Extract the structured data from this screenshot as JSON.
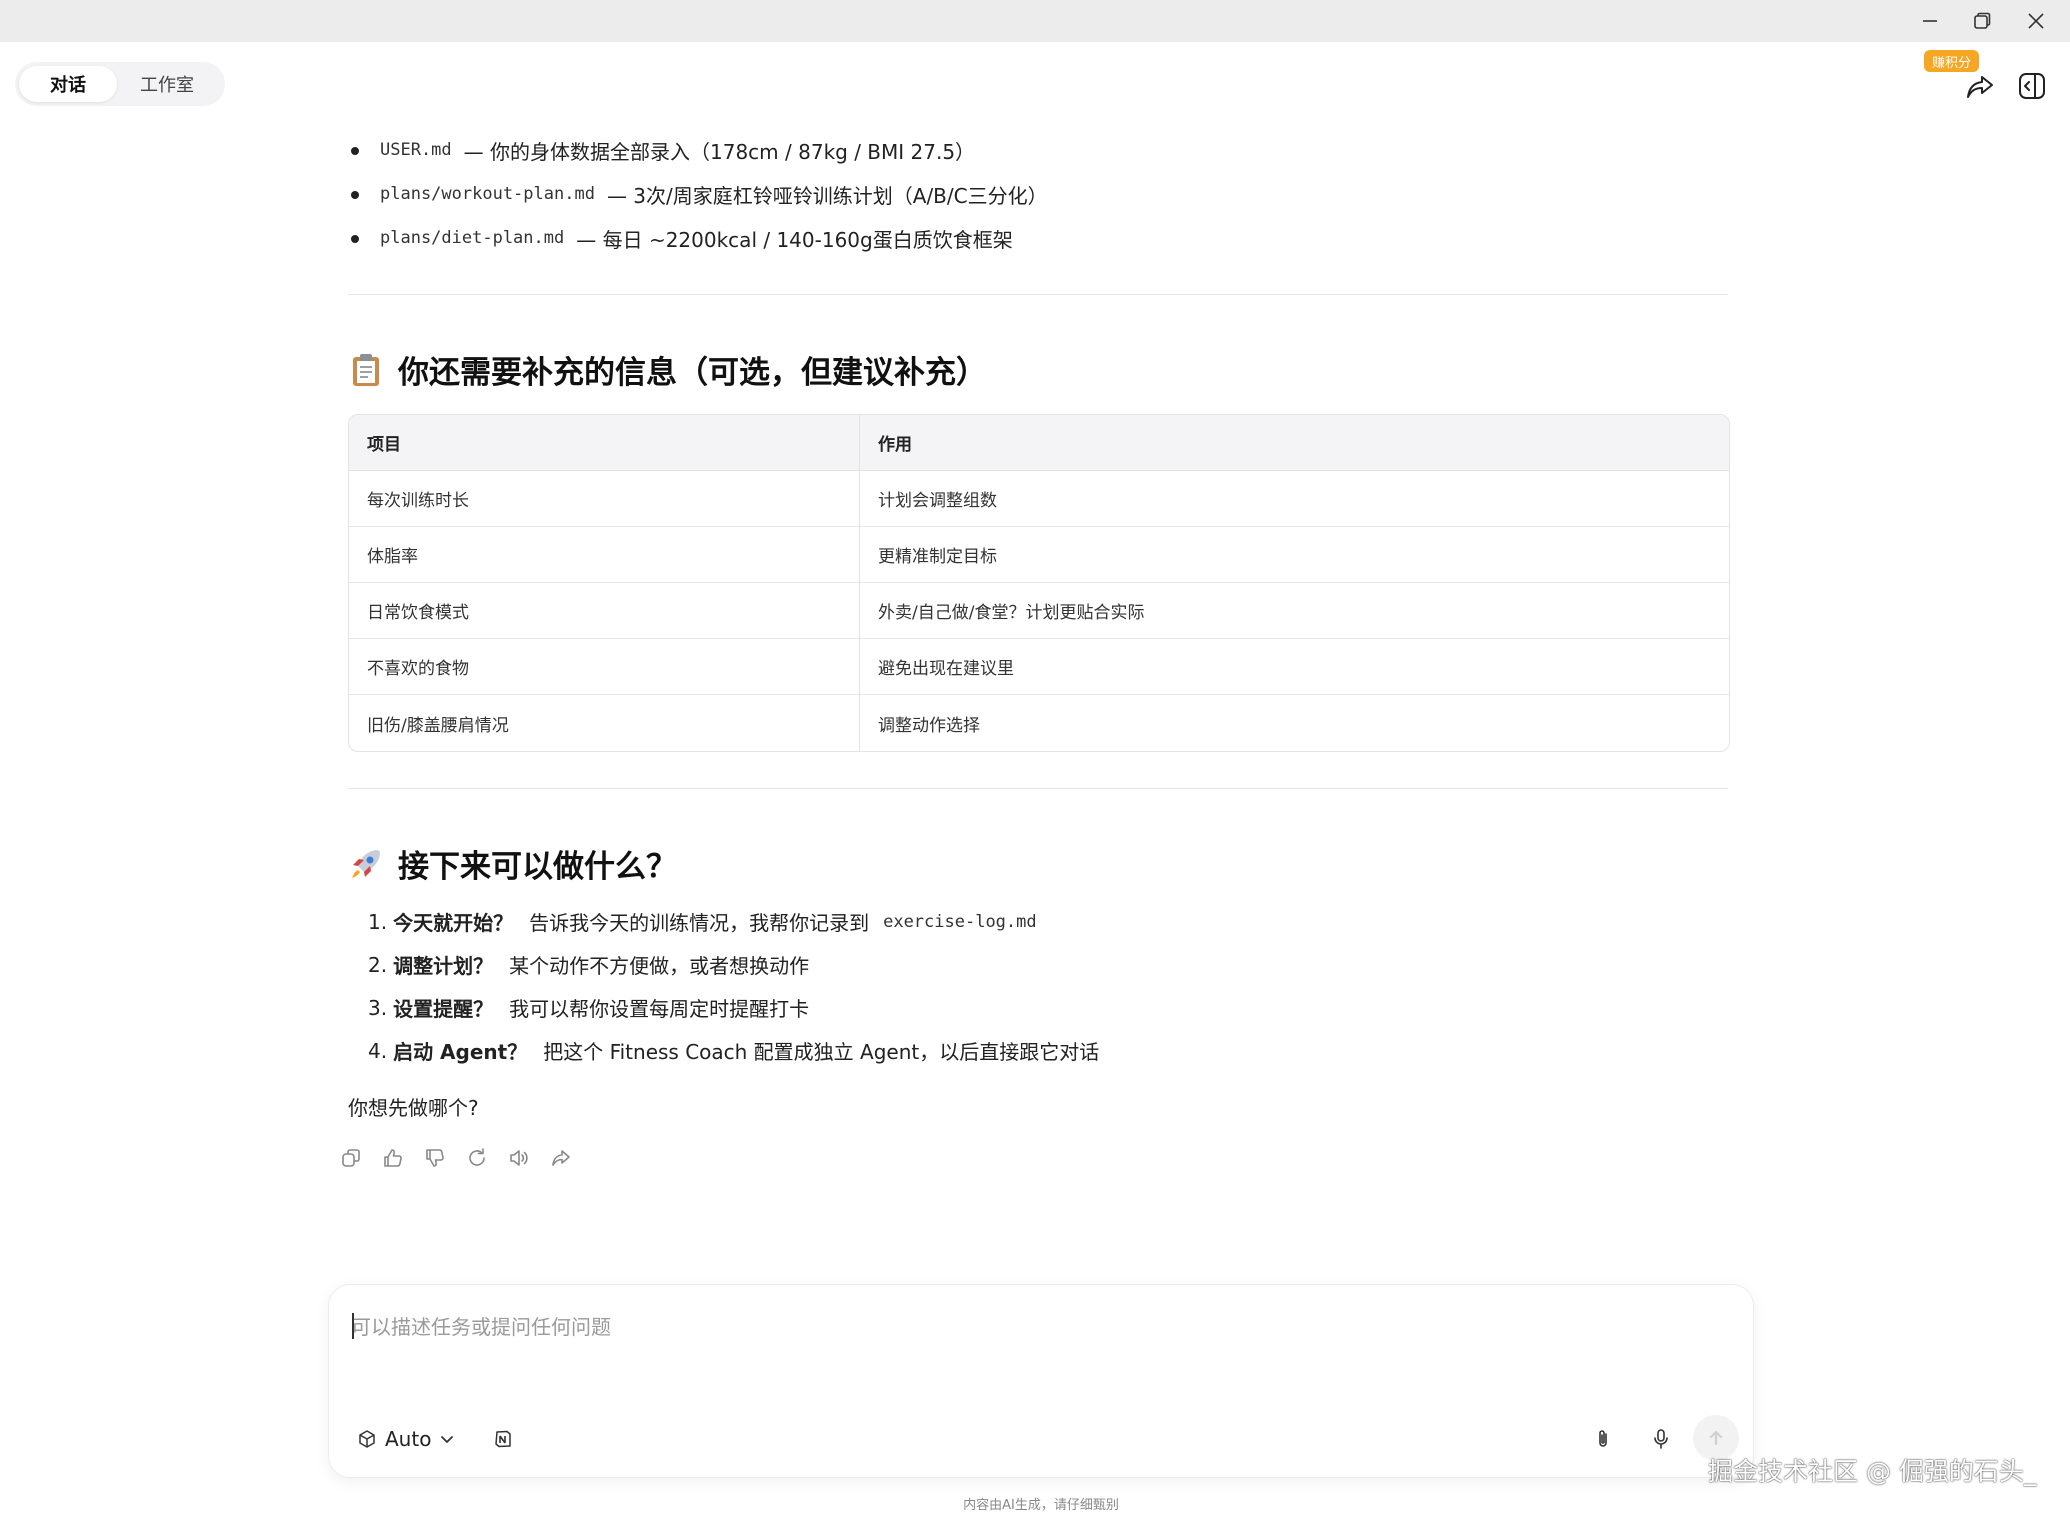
{
  "tabs": [
    {
      "label": "对话",
      "active": true
    },
    {
      "label": "工作室",
      "active": false
    }
  ],
  "header": {
    "points_badge": "赚积分"
  },
  "files": [
    {
      "code": "USER.md",
      "desc": "— 你的身体数据全部录入（178cm / 87kg / BMI 27.5）"
    },
    {
      "code": "plans/workout-plan.md",
      "desc": "— 3次/周家庭杠铃哑铃训练计划（A/B/C三分化）"
    },
    {
      "code": "plans/diet-plan.md",
      "desc": "— 每日 ~2200kcal / 140-160g蛋白质饮食框架"
    }
  ],
  "info_section": {
    "title": "你还需要补充的信息（可选，但建议补充）",
    "emoji_icon": "clipboard-icon",
    "headers": [
      "项目",
      "作用"
    ],
    "rows": [
      [
        "每次训练时长",
        "计划会调整组数"
      ],
      [
        "体脂率",
        "更精准制定目标"
      ],
      [
        "日常饮食模式",
        "外卖/自己做/食堂？计划更贴合实际"
      ],
      [
        "不喜欢的食物",
        "避免出现在建议里"
      ],
      [
        "旧伤/膝盖腰肩情况",
        "调整动作选择"
      ]
    ]
  },
  "next_section": {
    "title": "接下来可以做什么？",
    "emoji_icon": "rocket-icon",
    "steps": [
      {
        "num": "1.",
        "bold": "今天就开始？",
        "text": "告诉我今天的训练情况，我帮你记录到",
        "code": "exercise-log.md"
      },
      {
        "num": "2.",
        "bold": "调整计划？",
        "text": "某个动作不方便做，或者想换动作",
        "code": ""
      },
      {
        "num": "3.",
        "bold": "设置提醒？",
        "text": "我可以帮你设置每周定时提醒打卡",
        "code": ""
      },
      {
        "num": "4.",
        "bold": "启动 Agent？",
        "text": "把这个 Fitness Coach 配置成独立 Agent，以后直接跟它对话",
        "code": ""
      }
    ]
  },
  "question": "你想先做哪个?",
  "input": {
    "placeholder": "可以描述任务或提问任何问题",
    "model": "Auto"
  },
  "footer_note": "内容由AI生成，请仔细甄别",
  "watermark": "掘金技术社区 @ 倔强的石头_",
  "colors": {
    "badge": "#f5a623",
    "title_bar": "#ececec"
  }
}
